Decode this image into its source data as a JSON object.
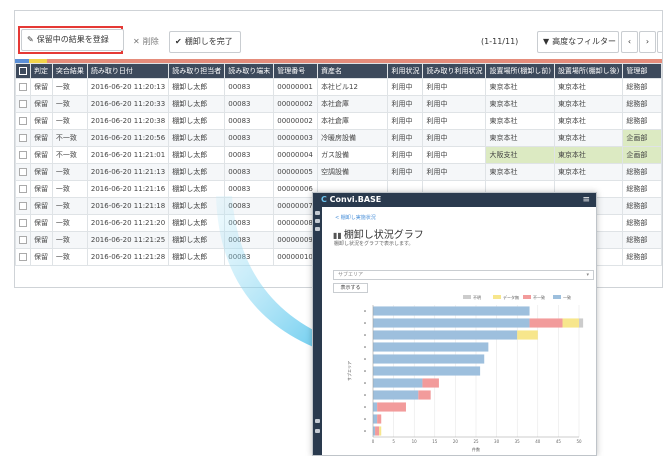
{
  "toolbar": {
    "save_label": "保留中の結果を登録",
    "delete_label": "削除",
    "complete_label": "棚卸しを完了",
    "count_text": "(1-11/11)",
    "filter_label": "高度なフィルター",
    "prev_icon": "‹",
    "next_icon": "›"
  },
  "table": {
    "headers": [
      "",
      "判定",
      "突合結果",
      "読み取り日付",
      "読み取り担当者",
      "読み取り端末",
      "管理番号",
      "資産名",
      "利用状況",
      "読み取り利用状況",
      "設置場所(棚卸し前)",
      "設置場所(棚卸し後)",
      "管理部"
    ],
    "rows": [
      [
        "保留",
        "一致",
        "2016-06-20 11:20:13",
        "棚卸し太郎",
        "00083",
        "00000001",
        "本社ビル12",
        "利用中",
        "利用中",
        "東京本社",
        "東京本社",
        "総務部"
      ],
      [
        "保留",
        "一致",
        "2016-06-20 11:20:33",
        "棚卸し太郎",
        "00083",
        "00000002",
        "本社倉庫",
        "利用中",
        "利用中",
        "東京本社",
        "東京本社",
        "総務部"
      ],
      [
        "保留",
        "一致",
        "2016-06-20 11:20:38",
        "棚卸し太郎",
        "00083",
        "00000002",
        "本社倉庫",
        "利用中",
        "利用中",
        "東京本社",
        "東京本社",
        "総務部"
      ],
      [
        "保留",
        "不一致",
        "2016-06-20 11:20:56",
        "棚卸し太郎",
        "00083",
        "00000003",
        "冷暖房設備",
        "利用中",
        "利用中",
        "東京本社",
        "東京本社",
        "企画部"
      ],
      [
        "保留",
        "不一致",
        "2016-06-20 11:21:01",
        "棚卸し太郎",
        "00083",
        "00000004",
        "ガス設備",
        "利用中",
        "利用中",
        "大阪支社",
        "東京本社",
        "企画部"
      ],
      [
        "保留",
        "一致",
        "2016-06-20 11:21:13",
        "棚卸し太郎",
        "00083",
        "00000005",
        "空調設備",
        "利用中",
        "利用中",
        "東京本社",
        "東京本社",
        "総務部"
      ],
      [
        "保留",
        "一致",
        "2016-06-20 11:21:16",
        "棚卸し太郎",
        "00083",
        "00000006",
        "",
        "",
        "",
        "",
        "",
        "総務部"
      ],
      [
        "保留",
        "一致",
        "2016-06-20 11:21:18",
        "棚卸し太郎",
        "00083",
        "00000007",
        "",
        "",
        "",
        "",
        "",
        "総務部"
      ],
      [
        "保留",
        "一致",
        "2016-06-20 11:21:20",
        "棚卸し太郎",
        "00083",
        "00000008",
        "",
        "",
        "",
        "",
        "",
        "総務部"
      ],
      [
        "保留",
        "一致",
        "2016-06-20 11:21:25",
        "棚卸し太郎",
        "00083",
        "00000009",
        "",
        "",
        "",
        "",
        "",
        "総務部"
      ],
      [
        "保留",
        "一致",
        "2016-06-20 11:21:28",
        "棚卸し太郎",
        "00083",
        "00000010",
        "",
        "",
        "",
        "",
        "",
        "総務部"
      ]
    ]
  },
  "phone": {
    "brand": "Convi.BASE",
    "back_link": "< 棚卸し実施状況",
    "title": "棚卸し状況グラフ",
    "description": "棚卸し状況をグラフで表示します。",
    "select_value": "サブエリア",
    "button_label": "表示する"
  },
  "chart_data": {
    "type": "bar",
    "orientation": "horizontal",
    "stacked": true,
    "legend_position": "top-right",
    "series": [
      {
        "name": "一致",
        "color": "#9dbfdd",
        "values": [
          38,
          38,
          35,
          28,
          27,
          26,
          12,
          11,
          1,
          1,
          0.5
        ]
      },
      {
        "name": "不一致",
        "color": "#f29b9b",
        "values": [
          0,
          8,
          0,
          0,
          0,
          0,
          4,
          3,
          7,
          1,
          1
        ]
      },
      {
        "name": "データ無",
        "color": "#f7e68c",
        "values": [
          0,
          4,
          5,
          0,
          0,
          0,
          0,
          0,
          0,
          0,
          0.5
        ]
      },
      {
        "name": "不明",
        "color": "#cccccc",
        "values": [
          0,
          1,
          0,
          0,
          0,
          0,
          0,
          0,
          0,
          0,
          0
        ]
      }
    ],
    "x_ticks": [
      "0",
      "5",
      "10",
      "15",
      "20",
      "25",
      "30",
      "35",
      "40",
      "45",
      "50"
    ],
    "xlim": [
      0,
      50
    ],
    "xlabel": "件数",
    "ylabel": "サブエリア",
    "grid": true
  }
}
